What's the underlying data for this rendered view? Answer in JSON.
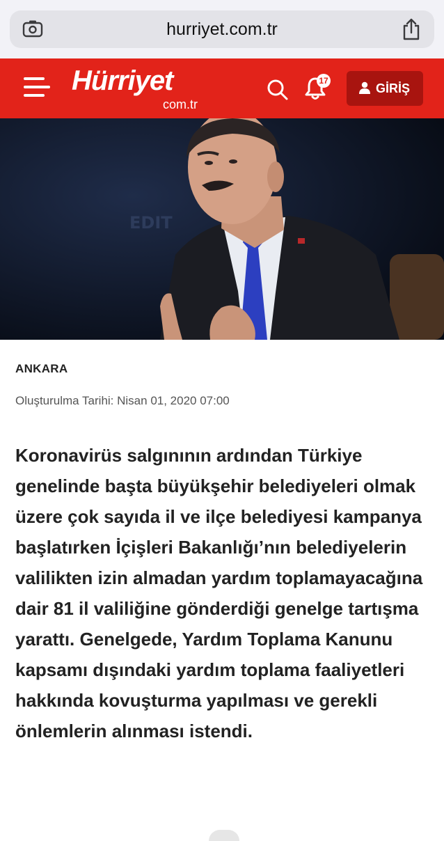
{
  "browser": {
    "url": "hurriyet.com.tr",
    "left_icon": "page-settings-icon",
    "right_icon": "share-icon"
  },
  "header": {
    "logo_main": "Hürriyet",
    "logo_sub": "com.tr",
    "notification_count": "17",
    "login_label": "GİRİŞ",
    "brand_color": "#e2231a",
    "button_color": "#a8140f"
  },
  "hero": {
    "icon": "news-photo"
  },
  "article": {
    "location": "ANKARA",
    "created": "Oluşturulma Tarihi: Nisan 01, 2020 07:00",
    "lead": "Koronavirüs salgınının ardından Türkiye genelinde başta büyükşehir belediyeleri olmak üzere çok sayıda il ve ilçe belediyesi kampanya başlatırken İçişleri Bakanlığı’nın belediyelerin valilikten izin almadan yardım toplamayacağına dair 81 il valiliğine gönderdiği genelge tartışma yarattı. Genelgede, Yardım Toplama Kanunu kapsamı dışındaki yardım toplama faaliyetleri hakkında kovuşturma yapılması ve gerekli önlemlerin alınması istendi."
  }
}
